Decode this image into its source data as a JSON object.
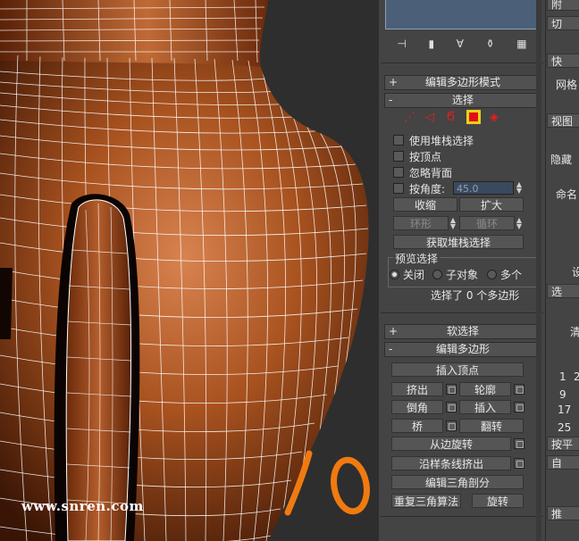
{
  "viewport": {
    "watermark": "www.snren.com",
    "annotation": "10"
  },
  "panel": {
    "rollouts": {
      "edit_poly_mode": "编辑多边形模式",
      "selection": "选择",
      "soft_selection": "软选择",
      "edit_polygons": "编辑多边形"
    },
    "selection": {
      "use_stack_selection": "使用堆栈选择",
      "by_vertex": "按顶点",
      "ignore_backfacing": "忽略背面",
      "by_angle": "按角度:",
      "angle_value": "45.0",
      "shrink": "收缩",
      "grow": "扩大",
      "ring": "环形",
      "loop": "循环",
      "get_stack_selection": "获取堆栈选择",
      "preview_selection": "预览选择",
      "preview_off": "关闭",
      "preview_subobject": "子对象",
      "preview_multi": "多个",
      "status": "选择了 0 个多边形"
    },
    "edit_polygons": {
      "insert_vertex": "插入顶点",
      "extrude": "挤出",
      "outline": "轮廓",
      "bevel": "倒角",
      "inset": "插入",
      "bridge": "桥",
      "flip": "翻转",
      "hinge_from_edge": "从边旋转",
      "extrude_along_spline": "沿样条线挤出",
      "edit_triangulation": "编辑三角剖分",
      "retriangulate": "重复三角算法",
      "turn": "旋转"
    }
  },
  "right_strip": {
    "items": [
      "附",
      "切",
      "快",
      "网格",
      "视图",
      "隐藏",
      "命名",
      "设",
      "选",
      "清",
      "按平",
      "自",
      "推"
    ],
    "numbers": [
      "1",
      "2",
      "9",
      "17",
      "25"
    ]
  },
  "colors": {
    "vase_base": "#8a3d12",
    "vase_highlight": "#d07a45",
    "wireframe": "#ffffff",
    "annotation": "#f07a10",
    "active_icon": "#e01010",
    "active_icon_border": "#e8d21a"
  }
}
